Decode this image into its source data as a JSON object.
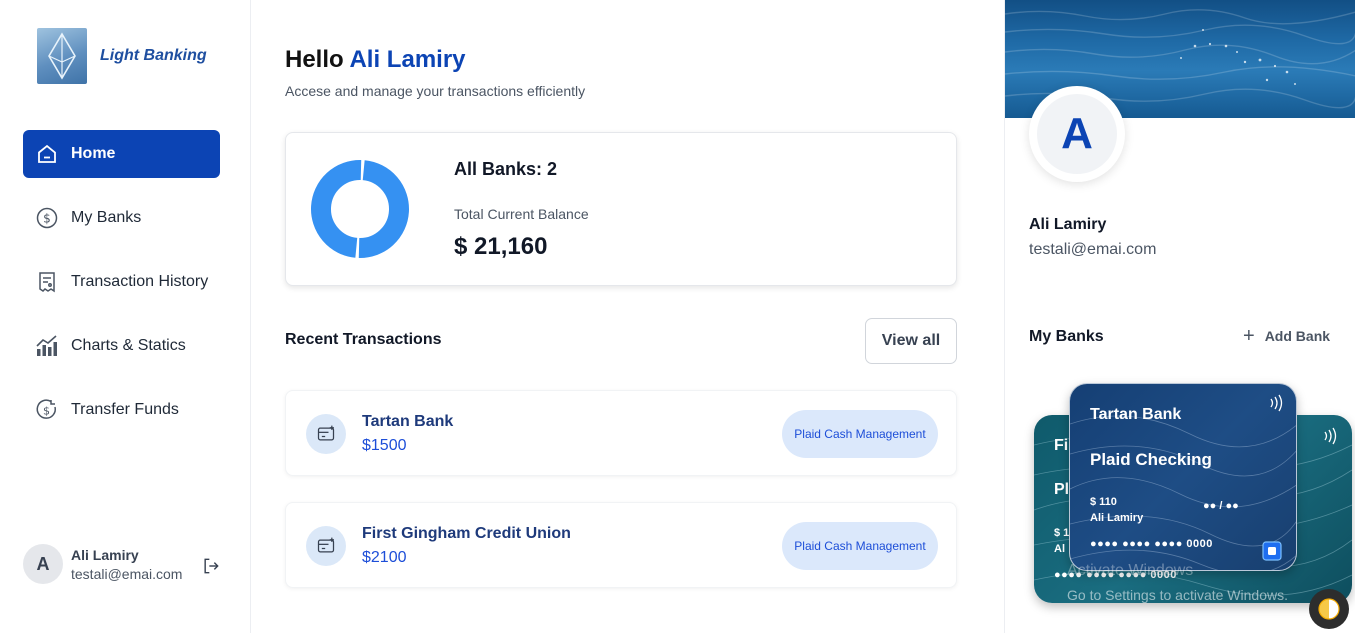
{
  "brand": {
    "name": "Light Banking"
  },
  "nav": [
    {
      "label": "Home",
      "icon": "home-icon"
    },
    {
      "label": "My Banks",
      "icon": "dollar-circle-icon"
    },
    {
      "label": "Transaction History",
      "icon": "receipt-icon"
    },
    {
      "label": "Charts & Statics",
      "icon": "chart-icon"
    },
    {
      "label": "Transfer Funds",
      "icon": "transfer-icon"
    }
  ],
  "sidebar_user": {
    "initial": "A",
    "name": "Ali Lamiry",
    "email": "testali@emai.com"
  },
  "header": {
    "greeting": "Hello",
    "user_name": "Ali Lamiry",
    "subtitle": "Accese and manage your transactions efficiently"
  },
  "balance": {
    "banks_count": "All Banks: 2",
    "label": "Total Current Balance",
    "value": "$ 21,160",
    "donut_color": "#3591f2",
    "donut_shares": [
      0.5,
      0.5
    ]
  },
  "recent": {
    "title": "Recent Transactions",
    "view_all": "View all",
    "items": [
      {
        "name": "Tartan Bank",
        "amount": "$1500",
        "badge": "Plaid Cash Management"
      },
      {
        "name": "First Gingham Credit Union",
        "amount": "$2100",
        "badge": "Plaid Cash Management"
      }
    ]
  },
  "profile": {
    "initial": "A",
    "name": "Ali Lamiry",
    "email": "testali@emai.com"
  },
  "my_banks": {
    "title": "My Banks",
    "add_label": "Add Bank",
    "front_card": {
      "bank": "Tartan Bank",
      "account": "Plaid Checking",
      "balance": "$ 110",
      "holder": "Ali Lamiry",
      "expiry": "●● / ●●",
      "number": "●●●● ●●●● ●●●● 0000"
    },
    "back_card": {
      "bank_partial": "Fi",
      "account_partial": "Pl",
      "balance_partial": "$ 1",
      "holder_partial": "Al",
      "number": "●●●● ●●●● ●●●● 0000"
    }
  },
  "watermark": {
    "line1": "Activate Windows",
    "line2": "Go to Settings to activate Windows."
  }
}
